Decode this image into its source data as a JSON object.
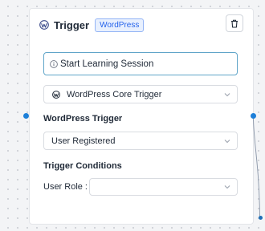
{
  "node": {
    "title": "Trigger",
    "badge": "WordPress",
    "icon": "wordpress-icon",
    "delete_icon": "trash-icon",
    "session_input": {
      "value": "Start Learning Session",
      "icon": "info-icon"
    },
    "core_select": {
      "value": "WordPress Core Trigger",
      "icon": "wordpress-icon"
    },
    "wp_trigger": {
      "label": "WordPress Trigger",
      "value": "User Registered"
    },
    "conditions": {
      "label": "Trigger Conditions",
      "role_label": "User Role",
      "role_colon": ":",
      "role_value": ""
    }
  },
  "colors": {
    "accent": "#1d7fd8",
    "badge_text": "#2563eb",
    "badge_bg": "#e8f0fe",
    "input_focus_border": "#60a5c9"
  }
}
